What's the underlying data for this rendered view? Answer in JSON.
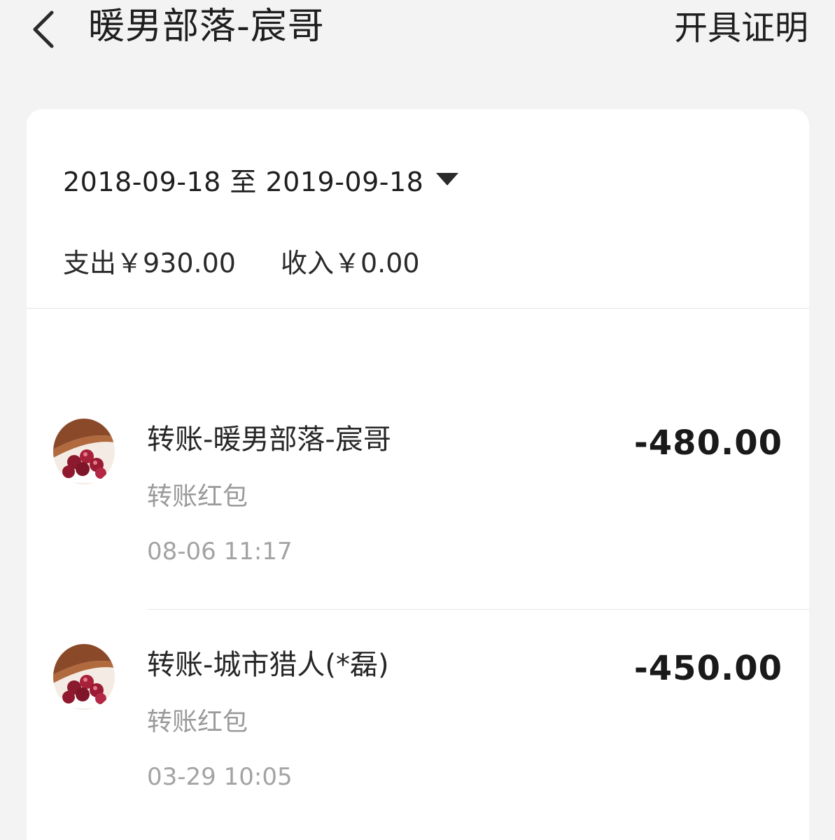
{
  "header": {
    "title": "暖男部落-宸哥",
    "action_label": "开具证明",
    "back_icon": "chevron-left-icon"
  },
  "filter": {
    "date_range": "2018-09-18 至 2019-09-18",
    "dropdown_icon": "caret-down-icon"
  },
  "summary": {
    "expense": "支出￥930.00",
    "income": "收入￥0.00"
  },
  "transactions": [
    {
      "name": "转账-暖男部落-宸哥",
      "type": "转账红包",
      "time": "08-06 11:17",
      "amount": "-480.00",
      "avatar_icon": "berries-avatar"
    },
    {
      "name": "转账-城市猎人(*磊)",
      "type": "转账红包",
      "time": "03-29 10:05",
      "amount": "-450.00",
      "avatar_icon": "berries-avatar"
    }
  ],
  "colors": {
    "background": "#f3f3f3",
    "card": "#ffffff",
    "primary_text": "#1e1e1e",
    "secondary_text": "#9a9a9a"
  }
}
